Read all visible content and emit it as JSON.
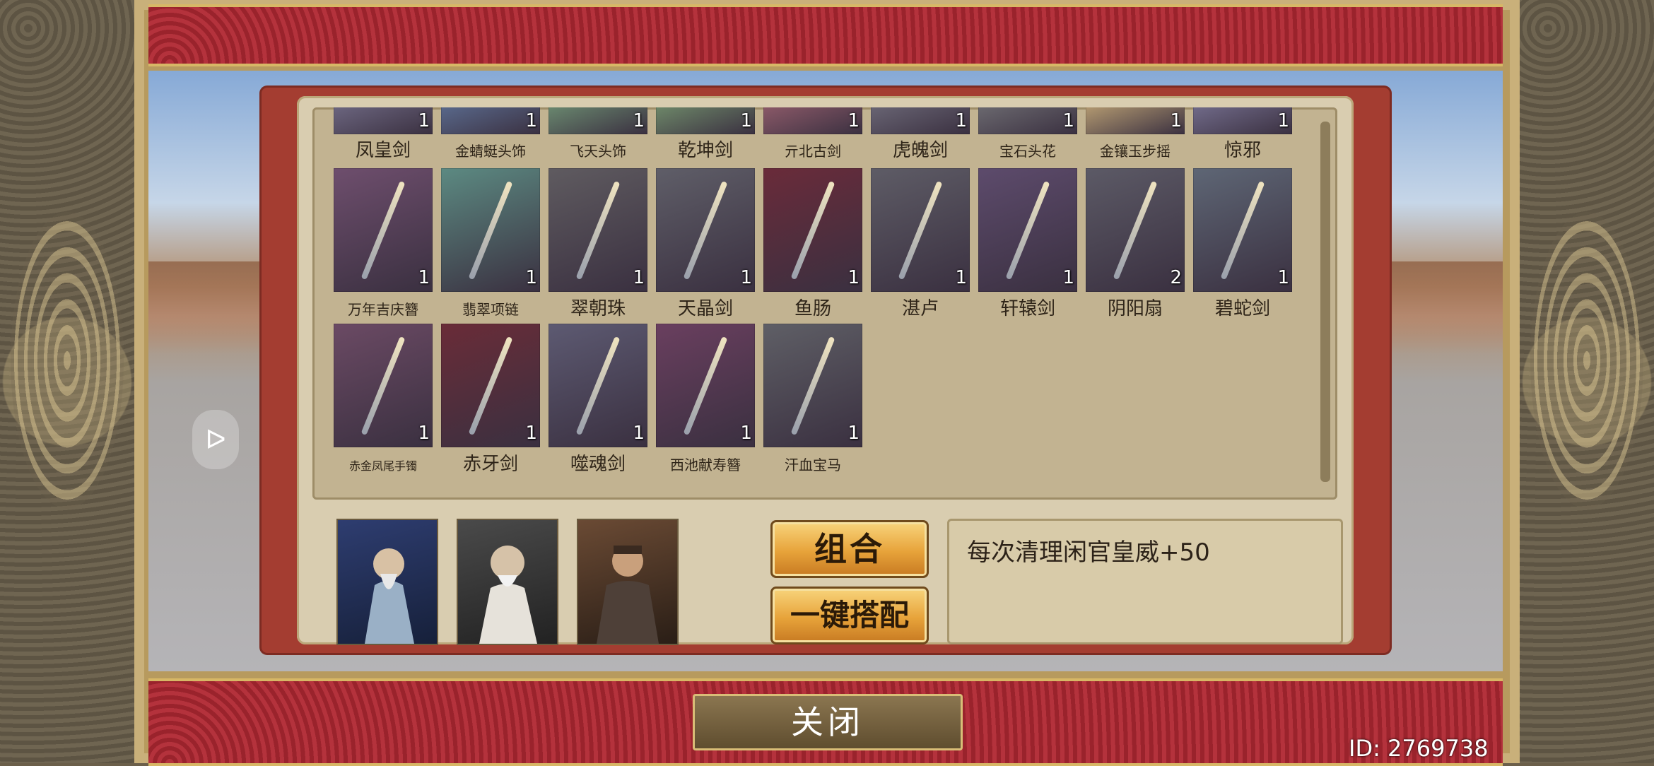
{
  "items_row0": [
    {
      "name": "凤皇剑",
      "qty": "1",
      "size": "normal",
      "bg": "#6d6781"
    },
    {
      "name": "金蜻蜓头饰",
      "qty": "1",
      "size": "small",
      "bg": "#5a6a8d"
    },
    {
      "name": "飞天头饰",
      "qty": "1",
      "size": "small",
      "bg": "#6b8a70"
    },
    {
      "name": "乾坤剑",
      "qty": "1",
      "size": "normal",
      "bg": "#6f8a6a"
    },
    {
      "name": "亓北古剑",
      "qty": "1",
      "size": "small",
      "bg": "#8d5a69"
    },
    {
      "name": "虎魄剑",
      "qty": "1",
      "size": "normal",
      "bg": "#6a6675"
    },
    {
      "name": "宝石头花",
      "qty": "1",
      "size": "small",
      "bg": "#6c6a70"
    },
    {
      "name": "金镶玉步摇",
      "qty": "1",
      "size": "small",
      "bg": "#b69c72"
    },
    {
      "name": "惊邪",
      "qty": "1",
      "size": "normal",
      "bg": "#726c8b"
    }
  ],
  "items_row1": [
    {
      "name": "万年吉庆簪",
      "qty": "1",
      "size": "small",
      "bg": "#6e4e6d"
    },
    {
      "name": "翡翠项链",
      "qty": "1",
      "size": "small",
      "bg": "#5c8a82"
    },
    {
      "name": "翠朝珠",
      "qty": "1",
      "size": "normal",
      "bg": "#5f5b60"
    },
    {
      "name": "天晶剑",
      "qty": "1",
      "size": "normal",
      "bg": "#5f5e68"
    },
    {
      "name": "鱼肠",
      "qty": "1",
      "size": "normal",
      "bg": "#6a2b3a"
    },
    {
      "name": "湛卢",
      "qty": "1",
      "size": "normal",
      "bg": "#5e5c66"
    },
    {
      "name": "轩辕剑",
      "qty": "1",
      "size": "normal",
      "bg": "#5d4b6c"
    },
    {
      "name": "阴阳扇",
      "qty": "2",
      "size": "normal",
      "bg": "#5c5a66"
    },
    {
      "name": "碧蛇剑",
      "qty": "1",
      "size": "normal",
      "bg": "#5e6675"
    }
  ],
  "items_row2": [
    {
      "name": "赤金凤尾手镯",
      "qty": "1",
      "size": "tiny",
      "bg": "#6b4a64"
    },
    {
      "name": "赤牙剑",
      "qty": "1",
      "size": "normal",
      "bg": "#6a2c38"
    },
    {
      "name": "噬魂剑",
      "qty": "1",
      "size": "normal",
      "bg": "#5d5a72"
    },
    {
      "name": "西池献寿簪",
      "qty": "1",
      "size": "small",
      "bg": "#6a3f5f"
    },
    {
      "name": "汗血宝马",
      "qty": "1",
      "size": "small",
      "bg": "#5f5f66"
    }
  ],
  "buttons": {
    "combine": "组合",
    "auto_match": "一键搭配",
    "close": "关闭"
  },
  "description": "每次清理闲官皇威+50",
  "player_id": "ID: 2769738",
  "back_icon": "ᐅ"
}
